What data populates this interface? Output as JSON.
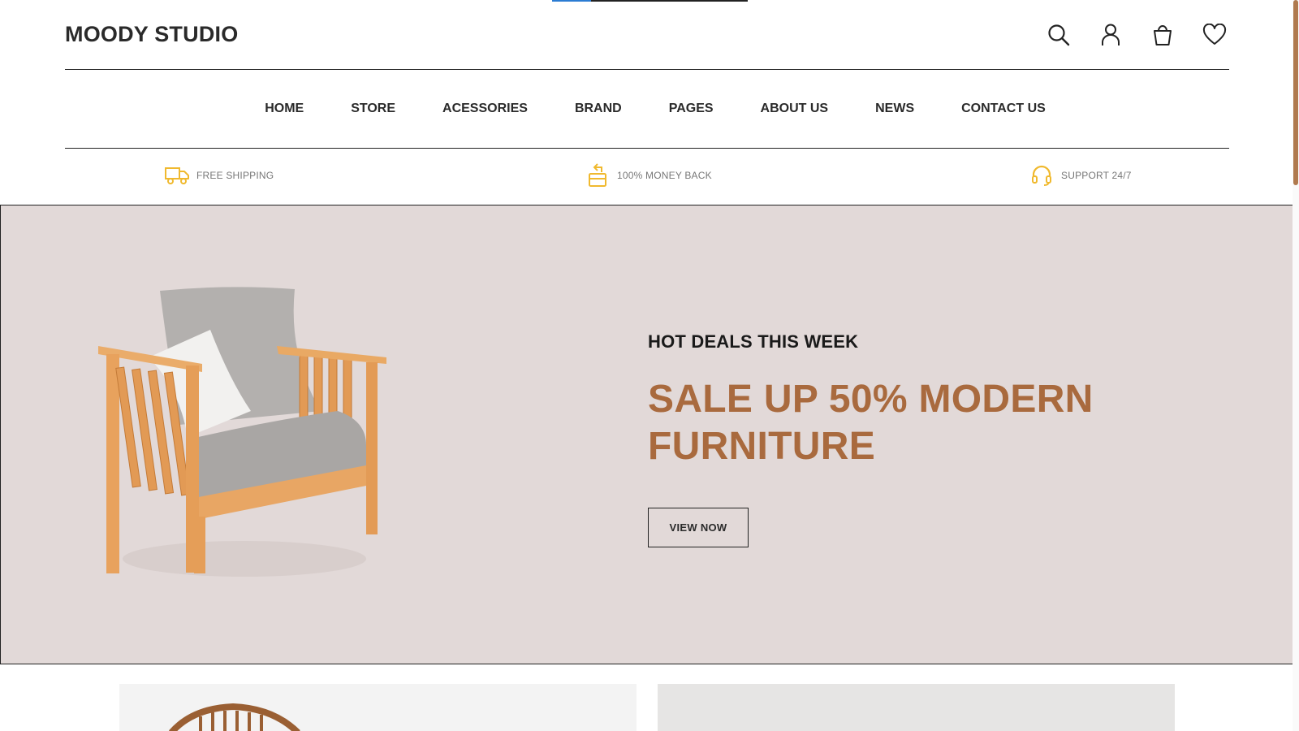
{
  "brand": {
    "logo_text": "MOODY STUDIO"
  },
  "header": {
    "icons": [
      "search-icon",
      "user-icon",
      "shopping-bag-icon",
      "heart-icon"
    ]
  },
  "nav": {
    "items": [
      "HOME",
      "STORE",
      "ACESSORIES",
      "BRAND",
      "PAGES",
      "ABOUT US",
      "NEWS",
      "CONTACT US"
    ]
  },
  "features": [
    {
      "icon": "truck-icon",
      "label": "FREE SHIPPING"
    },
    {
      "icon": "money-back-icon",
      "label": "100% MONEY BACK"
    },
    {
      "icon": "headset-icon",
      "label": "SUPPORT 24/7"
    }
  ],
  "hero": {
    "kicker": "HOT DEALS THIS WEEK",
    "title_line1": "SALE UP 50% MODERN",
    "title_line2": "FURNITURE",
    "button_label": "VIEW NOW",
    "image": "wooden-armchair-with-cushions"
  },
  "colors": {
    "accent": "#a96a3e",
    "feature_icon": "#f0b92e",
    "hero_bg": "#e2d9d8",
    "loading_bar": "#2b7cd3"
  },
  "page_load_progress": 0.2
}
